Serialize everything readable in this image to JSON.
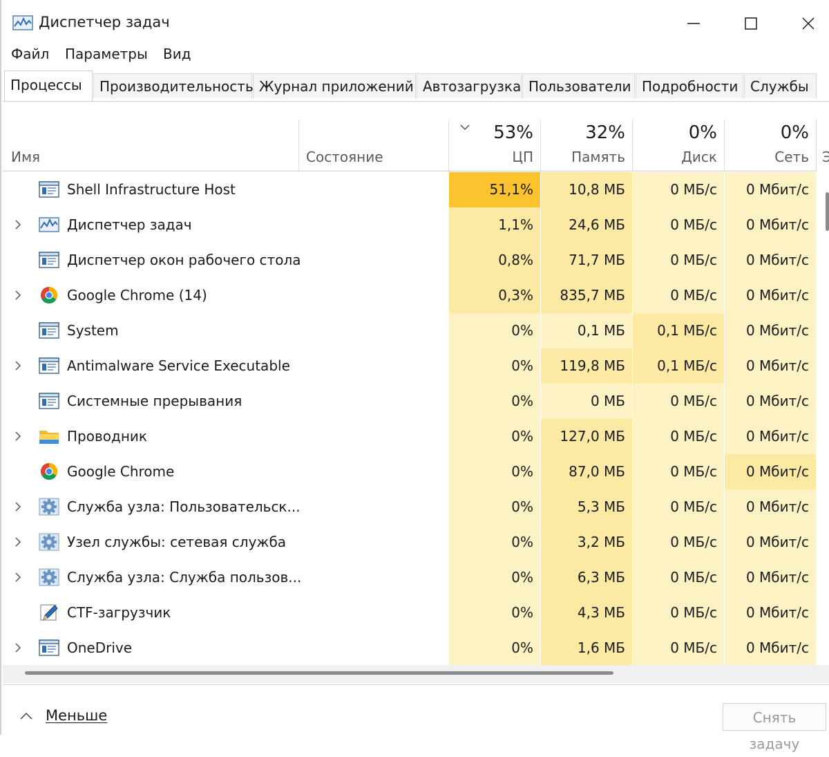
{
  "window": {
    "title": "Диспетчер задач",
    "icon": "task-manager-icon",
    "controls": [
      "minimize",
      "maximize",
      "close"
    ]
  },
  "menu": [
    "Файл",
    "Параметры",
    "Вид"
  ],
  "tabs": [
    {
      "label": "Процессы",
      "active": true
    },
    {
      "label": "Производительность",
      "active": false
    },
    {
      "label": "Журнал приложений",
      "active": false
    },
    {
      "label": "Автозагрузка",
      "active": false
    },
    {
      "label": "Пользователи",
      "active": false
    },
    {
      "label": "Подробности",
      "active": false
    },
    {
      "label": "Службы",
      "active": false
    }
  ],
  "columns": {
    "name": {
      "label": "Имя"
    },
    "status": {
      "label": "Состояние"
    },
    "cpu": {
      "label": "ЦП",
      "total": "53%",
      "sorted": true
    },
    "memory": {
      "label": "Память",
      "total": "32%"
    },
    "disk": {
      "label": "Диск",
      "total": "0%"
    },
    "network": {
      "label": "Сеть",
      "total": "0%"
    },
    "truncated": "Э"
  },
  "processes": [
    {
      "name": "Shell Infrastructure Host",
      "icon": "window-app-icon",
      "expandable": false,
      "cpu": "51,1%",
      "memory": "10,8 МБ",
      "disk": "0 МБ/с",
      "network": "0 Мбит/с"
    },
    {
      "name": "Диспетчер задач",
      "icon": "task-manager-icon",
      "expandable": true,
      "cpu": "1,1%",
      "memory": "24,6 МБ",
      "disk": "0 МБ/с",
      "network": "0 Мбит/с"
    },
    {
      "name": "Диспетчер окон рабочего стола",
      "icon": "window-app-icon",
      "expandable": false,
      "cpu": "0,8%",
      "memory": "71,7 МБ",
      "disk": "0 МБ/с",
      "network": "0 Мбит/с"
    },
    {
      "name": "Google Chrome (14)",
      "icon": "chrome-icon",
      "expandable": true,
      "cpu": "0,3%",
      "memory": "835,7 МБ",
      "disk": "0 МБ/с",
      "network": "0 Мбит/с"
    },
    {
      "name": "System",
      "icon": "window-app-icon",
      "expandable": false,
      "cpu": "0%",
      "memory": "0,1 МБ",
      "disk": "0,1 МБ/с",
      "network": "0 Мбит/с"
    },
    {
      "name": "Antimalware Service Executable",
      "icon": "window-app-icon",
      "expandable": true,
      "cpu": "0%",
      "memory": "119,8 МБ",
      "disk": "0,1 МБ/с",
      "network": "0 Мбит/с"
    },
    {
      "name": "Системные прерывания",
      "icon": "window-app-icon",
      "expandable": false,
      "cpu": "0%",
      "memory": "0 МБ",
      "disk": "0 МБ/с",
      "network": "0 Мбит/с"
    },
    {
      "name": "Проводник",
      "icon": "folder-icon",
      "expandable": true,
      "cpu": "0%",
      "memory": "127,0 МБ",
      "disk": "0 МБ/с",
      "network": "0 Мбит/с"
    },
    {
      "name": "Google Chrome",
      "icon": "chrome-icon",
      "expandable": false,
      "cpu": "0%",
      "memory": "87,0 МБ",
      "disk": "0 МБ/с",
      "network": "0 Мбит/с"
    },
    {
      "name": "Служба узла: Пользовательск...",
      "icon": "gear-icon",
      "expandable": true,
      "cpu": "0%",
      "memory": "5,3 МБ",
      "disk": "0 МБ/с",
      "network": "0 Мбит/с"
    },
    {
      "name": "Узел службы: сетевая служба",
      "icon": "gear-icon",
      "expandable": true,
      "cpu": "0%",
      "memory": "3,2 МБ",
      "disk": "0 МБ/с",
      "network": "0 Мбит/с"
    },
    {
      "name": "Служба узла: Служба пользов...",
      "icon": "gear-icon",
      "expandable": true,
      "cpu": "0%",
      "memory": "6,3 МБ",
      "disk": "0 МБ/с",
      "network": "0 Мбит/с"
    },
    {
      "name": "CTF-загрузчик",
      "icon": "pen-icon",
      "expandable": false,
      "cpu": "0%",
      "memory": "4,3 МБ",
      "disk": "0 МБ/с",
      "network": "0 Мбит/с"
    },
    {
      "name": "OneDrive",
      "icon": "window-app-icon",
      "expandable": true,
      "cpu": "0%",
      "memory": "1,6 МБ",
      "disk": "0 МБ/с",
      "network": "0 Мбит/с"
    }
  ],
  "heat_colors": {
    "high": "#fcc32e",
    "medium": "#fbe9a4",
    "low": "#fdf2c4",
    "faint": "#fefadf"
  },
  "footer": {
    "less_label": "Меньше",
    "end_task_label": "Снять задачу"
  }
}
